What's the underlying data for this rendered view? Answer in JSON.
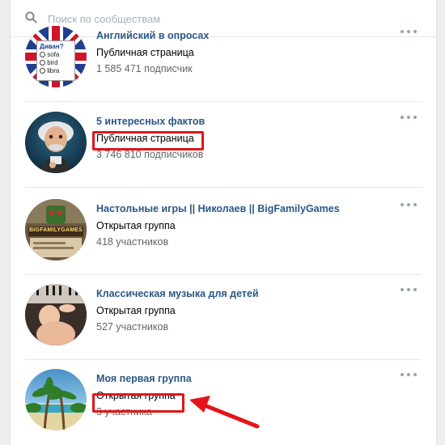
{
  "search": {
    "placeholder": "Поиск по сообществам"
  },
  "communities": [
    {
      "title": "Английский в опросах",
      "type": "Публичная страница",
      "count": "1 585 471 подписчик",
      "avatar": {
        "title": "Диван?",
        "options": [
          "sofa",
          "bird",
          "libra"
        ]
      }
    },
    {
      "title": "5 интересных фактов",
      "type": "Публичная страница",
      "count": "3 746 810 подписчиков"
    },
    {
      "title": "Настольные игры || Николаев || BigFamilyGames",
      "type": "Открытая группа",
      "count": "418 участников",
      "avatar": {
        "logo_text": "BIGFAMILYGAMES"
      }
    },
    {
      "title": "Классическая музыка для детей",
      "type": "Открытая группа",
      "count": "527 участников"
    },
    {
      "title": "Моя первая группа",
      "type": "Открытая группа",
      "count": "3 участника"
    }
  ],
  "colors": {
    "link": "#2a5885",
    "highlight": "#e3151a",
    "background": "#edeef0"
  }
}
